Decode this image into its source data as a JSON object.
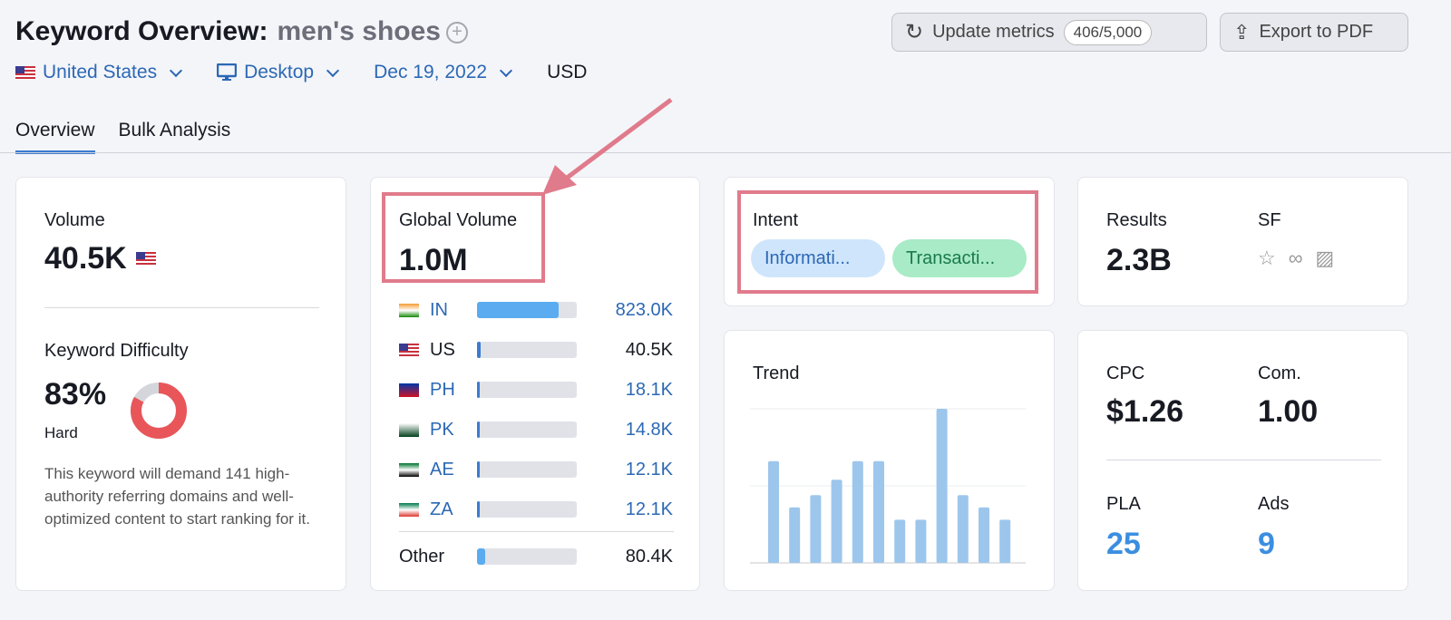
{
  "header": {
    "title": "Keyword Overview:",
    "keyword": "men's shoes",
    "add_icon": "plus-circle-icon",
    "filters": [
      {
        "label": "United States",
        "icon": "us-flag-icon"
      },
      {
        "label": "Desktop",
        "icon": "desktop-icon"
      },
      {
        "label": "Dec 19, 2022"
      }
    ],
    "currency": "USD",
    "update_button": "Update metrics",
    "update_count": "406/5,000",
    "export_button": "Export to PDF"
  },
  "tabs": [
    {
      "label": "Overview",
      "active": true
    },
    {
      "label": "Bulk Analysis"
    }
  ],
  "volume": {
    "label": "Volume",
    "value": "40.5K"
  },
  "difficulty": {
    "label": "Keyword Difficulty",
    "value": "83%",
    "percent": 83,
    "level": "Hard",
    "description": "This keyword will demand 141 high-authority referring domains and well-optimized content to start ranking for it.",
    "color": "#e8565a"
  },
  "global": {
    "label": "Global Volume",
    "value": "1.0M",
    "countries": [
      {
        "code": "IN",
        "value": "823.0K",
        "fill": 0.82,
        "link": true
      },
      {
        "code": "US",
        "value": "40.5K",
        "fill": 0.04,
        "link": false
      },
      {
        "code": "PH",
        "value": "18.1K",
        "fill": 0.03,
        "link": true
      },
      {
        "code": "PK",
        "value": "14.8K",
        "fill": 0.03,
        "link": true
      },
      {
        "code": "AE",
        "value": "12.1K",
        "fill": 0.03,
        "link": true
      },
      {
        "code": "ZA",
        "value": "12.1K",
        "fill": 0.03,
        "link": true
      }
    ],
    "other": {
      "label": "Other",
      "value": "80.4K",
      "fill": 0.08
    }
  },
  "intent": {
    "label": "Intent",
    "tags": [
      {
        "label": "Informati...",
        "bg": "#cfe5fb",
        "color": "#2c68b5"
      },
      {
        "label": "Transacti...",
        "bg": "#a8ebc6",
        "color": "#1b7a4a"
      }
    ]
  },
  "results": {
    "label": "Results",
    "value": "2.3B",
    "sf_label": "SF",
    "sf_icons": [
      "star-icon",
      "link-icon",
      "image-icon"
    ]
  },
  "trend": {
    "label": "Trend"
  },
  "chart_data": {
    "type": "bar",
    "values": [
      66,
      36,
      44,
      54,
      66,
      66,
      28,
      28,
      100,
      44,
      36,
      28
    ],
    "ylim": [
      0,
      100
    ],
    "grid": true,
    "color": "#9dc6ec"
  },
  "cpc": {
    "label": "CPC",
    "value": "$1.26"
  },
  "com": {
    "label": "Com.",
    "value": "1.00"
  },
  "pla": {
    "label": "PLA",
    "value": "25"
  },
  "ads": {
    "label": "Ads",
    "value": "9"
  },
  "annotation_color": "#e07b8c"
}
